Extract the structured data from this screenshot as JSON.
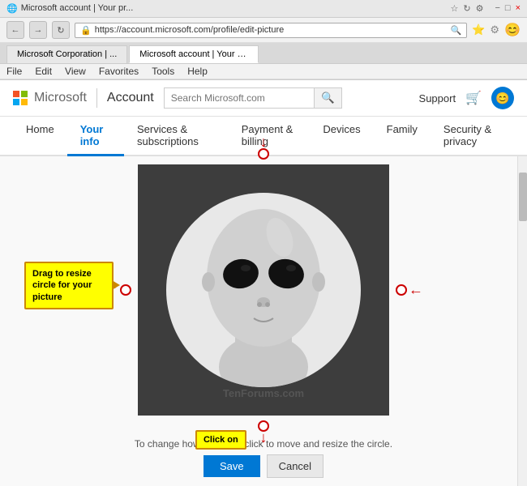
{
  "browser": {
    "title_left": "Microsoft account | Your pr...",
    "title_right_btn1": "−",
    "title_right_btn2": "□",
    "title_right_btn3": "×",
    "url": "https://account.microsoft.com/profile/edit-picture",
    "tab1_label": "Microsoft Corporation | ...",
    "tab2_label": "Microsoft account | Your pr...",
    "menu_items": [
      "File",
      "Edit",
      "View",
      "Favorites",
      "Tools",
      "Help"
    ]
  },
  "header": {
    "logo_text": "Microsoft",
    "account_label": "Account",
    "search_placeholder": "Search Microsoft.com",
    "support_label": "Support"
  },
  "nav": {
    "tabs": [
      {
        "label": "Home",
        "active": false
      },
      {
        "label": "Your info",
        "active": true
      },
      {
        "label": "Services & subscriptions",
        "active": false
      },
      {
        "label": "Payment & billing",
        "active": false
      },
      {
        "label": "Devices",
        "active": false
      },
      {
        "label": "Family",
        "active": false
      },
      {
        "label": "Security & privacy",
        "active": false
      }
    ]
  },
  "editor": {
    "tooltip_text": "Drag to resize circle for your picture",
    "instruction_text": "To change how you look, click to move and resize the circle.",
    "watermark": "TenForums.com",
    "click_on_label": "Click on",
    "save_label": "Save",
    "cancel_label": "Cancel"
  },
  "icons": {
    "search": "🔍",
    "cart": "🛒",
    "back": "←",
    "forward": "→",
    "refresh": "↻",
    "lock": "🔒"
  }
}
